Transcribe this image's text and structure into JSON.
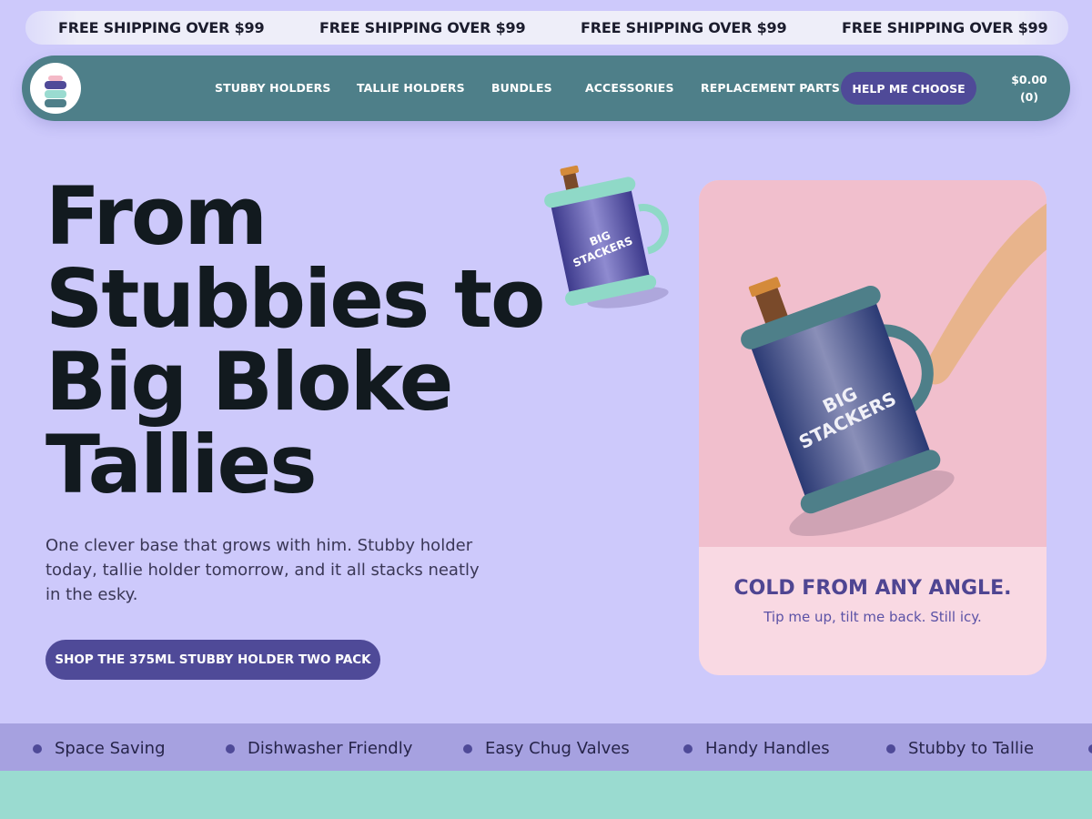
{
  "announcement": {
    "items": [
      "FREE SHIPPING OVER $99",
      "FREE SHIPPING OVER $99",
      "FREE SHIPPING OVER $99",
      "FREE SHIPPING OVER $99"
    ]
  },
  "nav": {
    "logo_icon": "stack-logo-icon",
    "links": [
      "STUBBY HOLDERS",
      "TALLIE HOLDERS",
      "BUNDLES",
      "ACCESSORIES",
      "REPLACEMENT PARTS"
    ],
    "help_button": "HELP ME CHOOSE",
    "cart": {
      "amount": "$0.00",
      "count": "(0)"
    }
  },
  "hero": {
    "title_lines": [
      "From",
      "Stubbies to",
      "Big Bloke",
      "Tallies"
    ],
    "subtitle": "One clever base that grows with him. Stubby holder today, tallie holder tomorrow, and it all stacks neatly in the esky.",
    "cta": "SHOP THE 375ML STUBBY HOLDER TWO PACK",
    "product_label": [
      "BIG",
      "STACKERS"
    ]
  },
  "card": {
    "title": "COLD FROM ANY ANGLE.",
    "subtitle": "Tip me up, tilt me back. Still icy.",
    "product_label": [
      "BIG",
      "STACKERS"
    ]
  },
  "features": [
    "Space Saving",
    "Dishwasher Friendly",
    "Easy Chug Valves",
    "Handy Handles",
    "Stubby to Tallie"
  ],
  "colors": {
    "background": "#cdc9fb",
    "nav": "#4e7f89",
    "accent": "#4f4a98",
    "card_image": "#f1bfcd",
    "card_body": "#f9d9e3",
    "strip": "#a6a1e0",
    "mint": "#9adbd0"
  }
}
